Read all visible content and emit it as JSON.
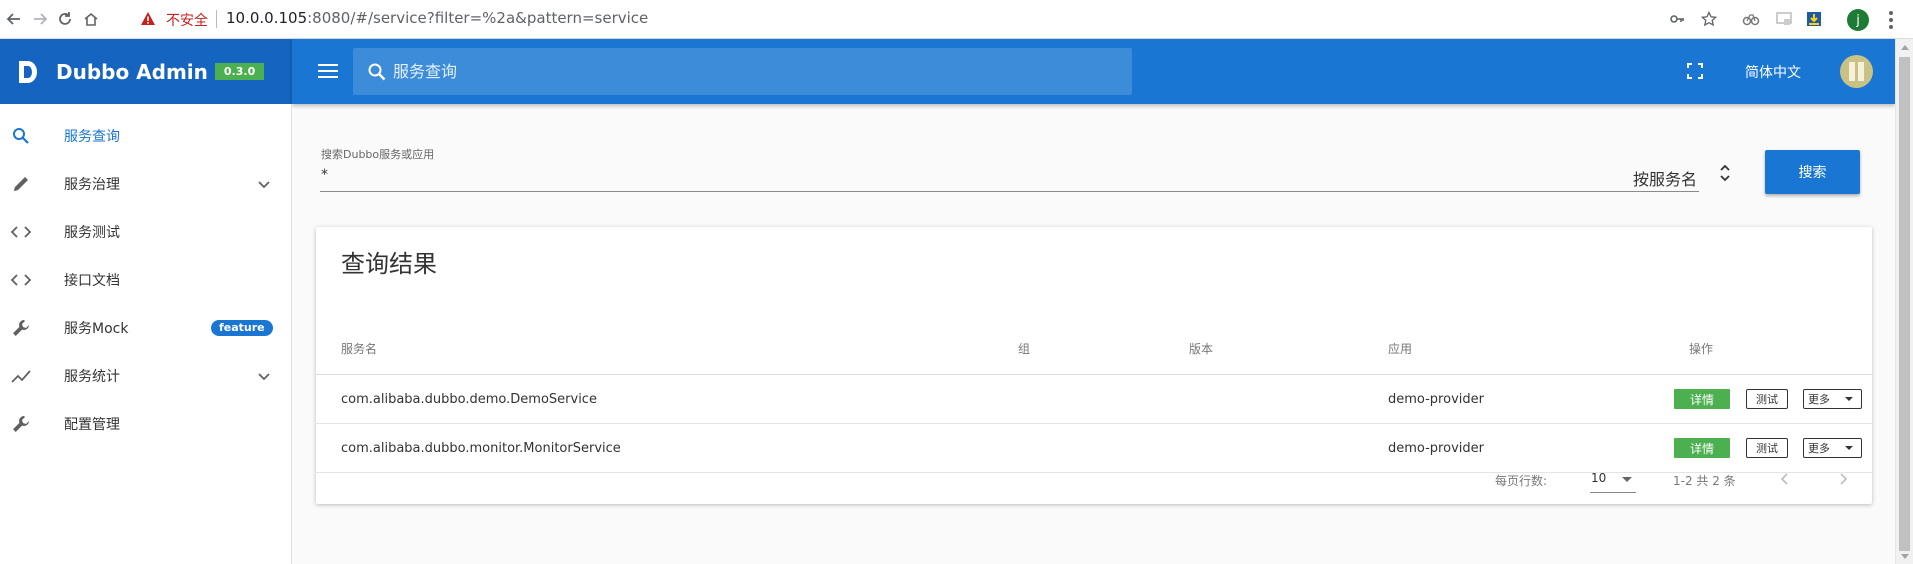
{
  "browser": {
    "insecure_label": "不安全",
    "url_host": "10.0.0.105",
    "url_rest": ":8080/#/service?filter=%2a&pattern=service",
    "profile_initial": "j"
  },
  "app": {
    "name": "Dubbo Admin",
    "version": "0.3.0",
    "search_placeholder": "服务查询",
    "language": "简体中文"
  },
  "sidebar": {
    "items": [
      {
        "label": "服务查询",
        "icon": "search-icon",
        "active": true
      },
      {
        "label": "服务治理",
        "icon": "pencil-icon",
        "expandable": true
      },
      {
        "label": "服务测试",
        "icon": "code-icon"
      },
      {
        "label": "接口文档",
        "icon": "code-icon"
      },
      {
        "label": "服务Mock",
        "icon": "wrench-icon",
        "badge": "feature"
      },
      {
        "label": "服务统计",
        "icon": "trending-icon",
        "expandable": true
      },
      {
        "label": "配置管理",
        "icon": "wrench-icon"
      }
    ]
  },
  "search_form": {
    "field_label": "搜索Dubbo服务或应用",
    "field_value": "*",
    "select_value": "按服务名",
    "button_label": "搜索"
  },
  "results": {
    "title": "查询结果",
    "columns": [
      "服务名",
      "组",
      "版本",
      "应用",
      "操作"
    ],
    "rows": [
      {
        "service": "com.alibaba.dubbo.demo.DemoService",
        "group": "",
        "version": "",
        "app": "demo-provider"
      },
      {
        "service": "com.alibaba.dubbo.monitor.MonitorService",
        "group": "",
        "version": "",
        "app": "demo-provider"
      }
    ],
    "actions": {
      "detail": "详情",
      "test": "测试",
      "more": "更多"
    },
    "rows_per_page_label": "每页行数:",
    "rows_per_page": "10",
    "page_info": "1-2 共 2 条"
  },
  "colors": {
    "brand_dark": "#1565c0",
    "appbar": "#1976d2",
    "version_badge": "#4caf50",
    "detail_button": "#4caf50",
    "active_nav": "#1976d2"
  }
}
